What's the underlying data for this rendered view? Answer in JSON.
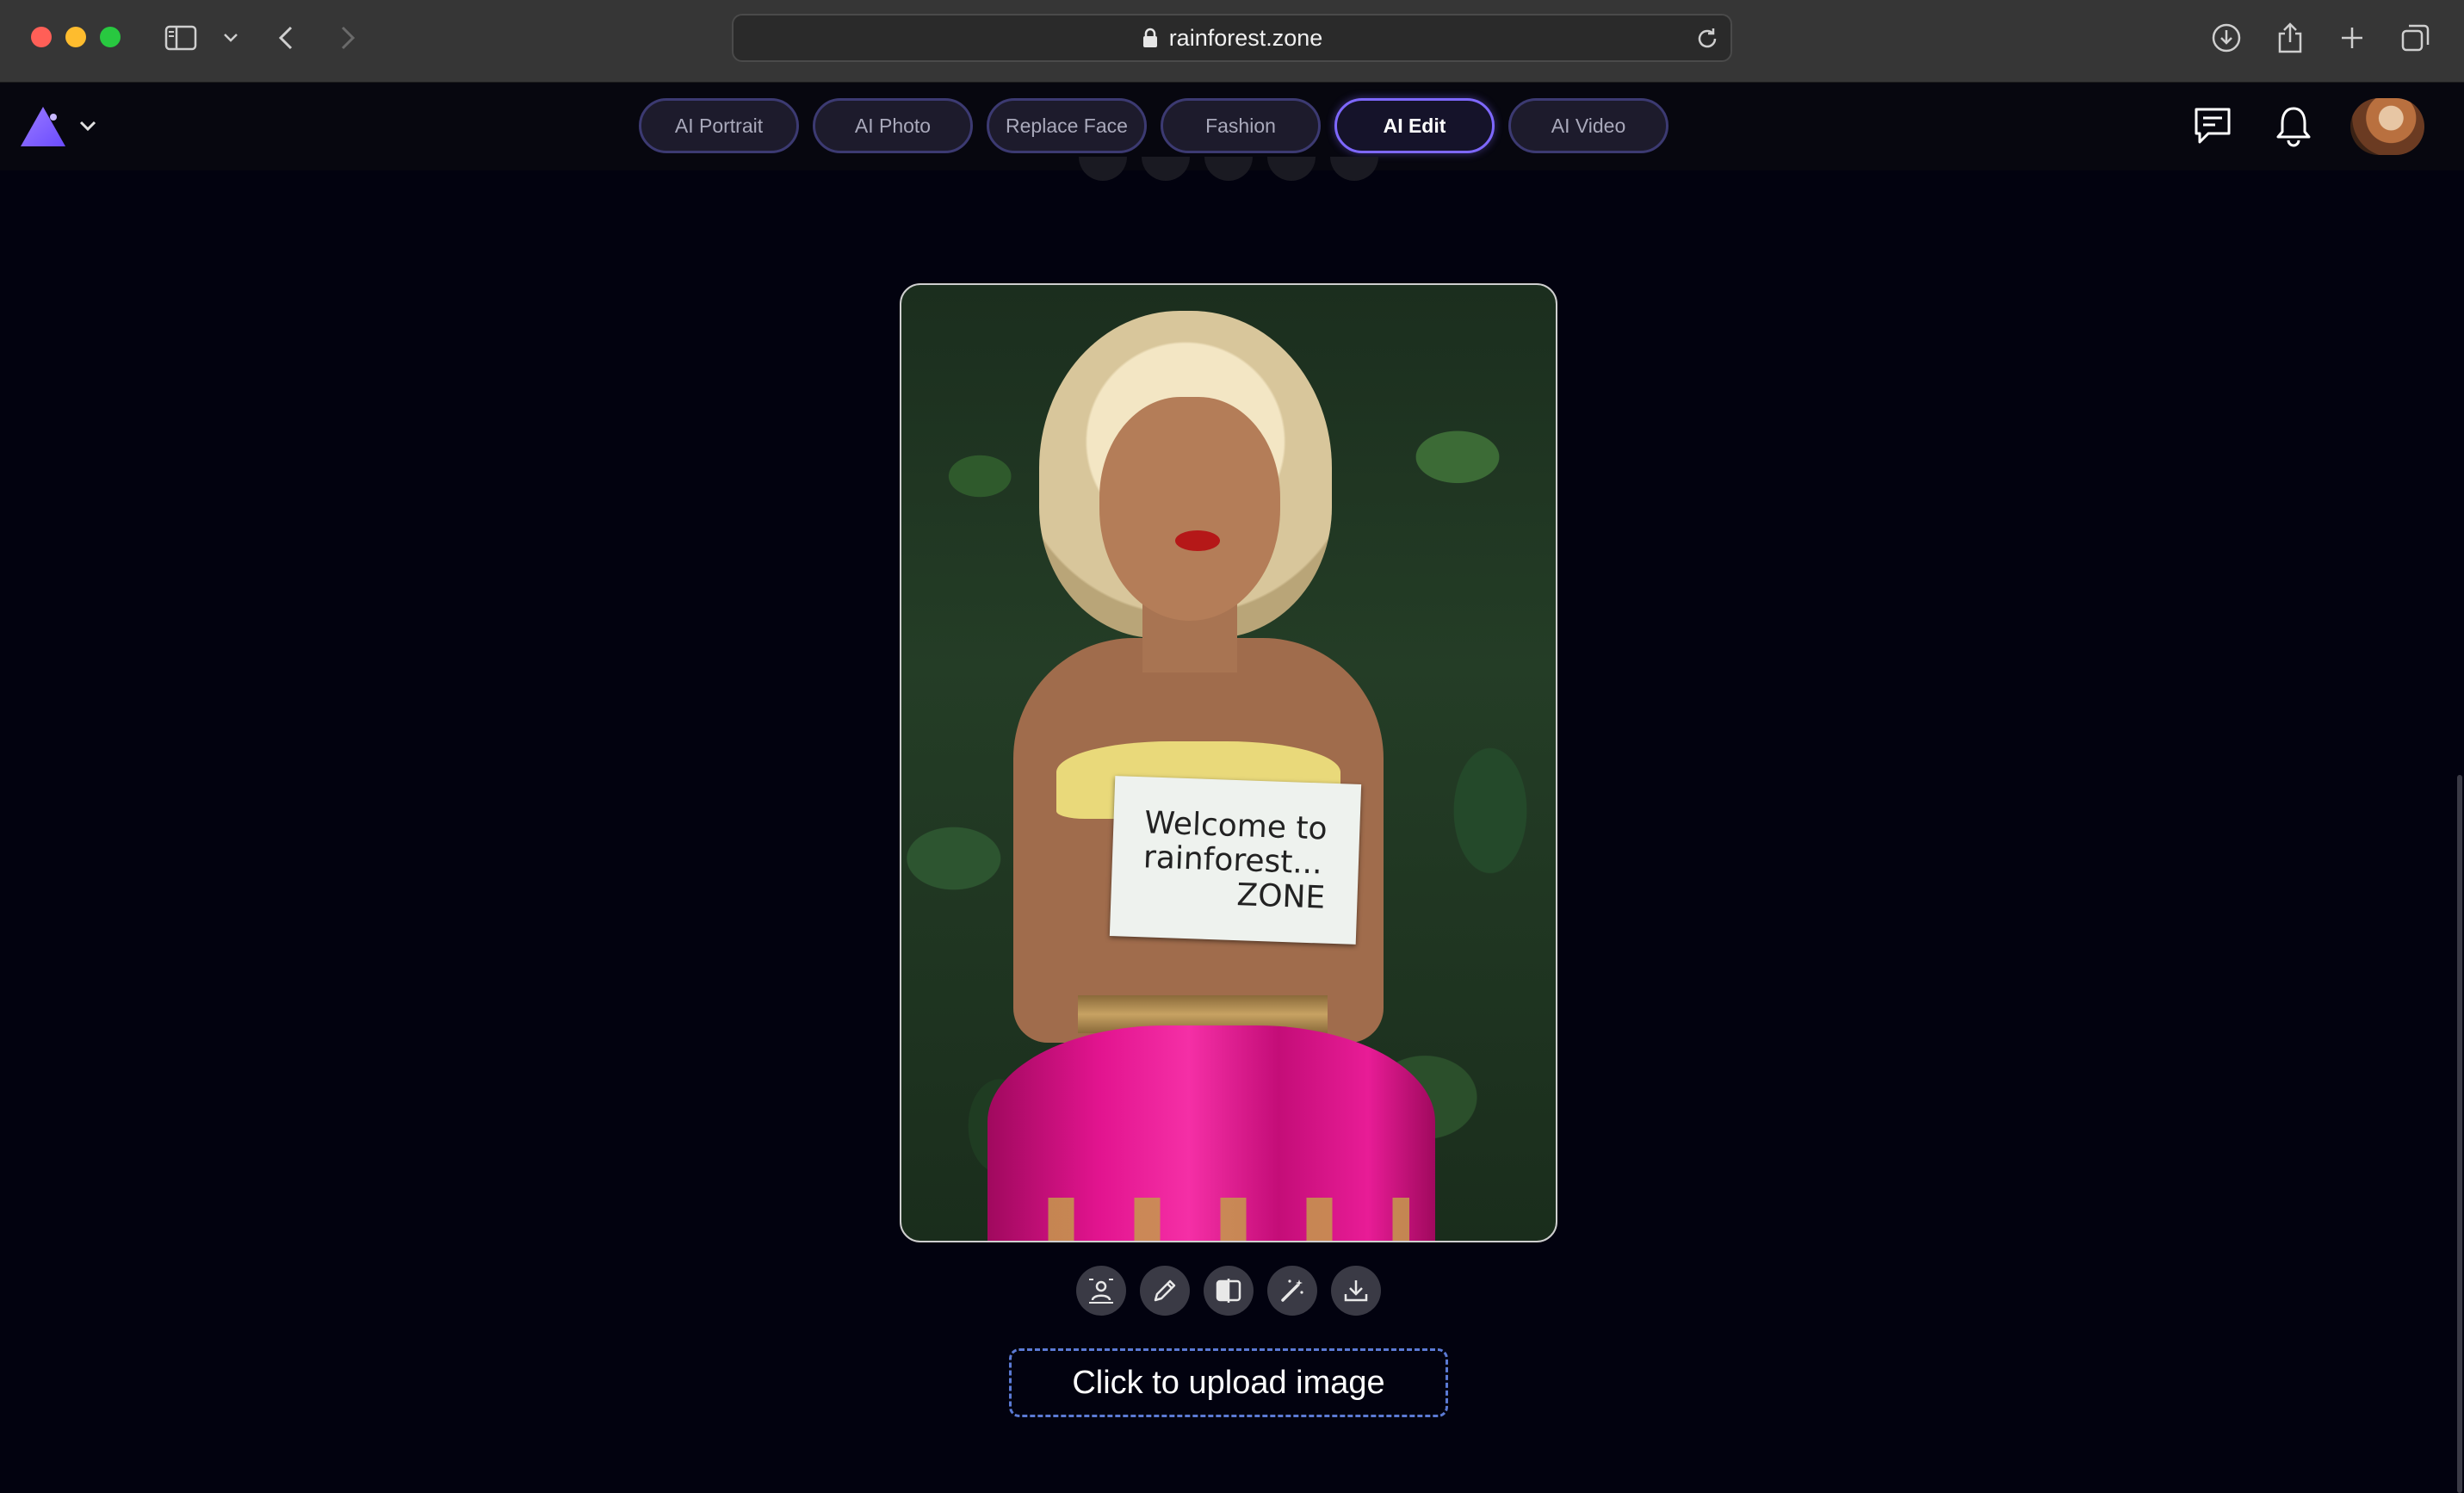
{
  "browser": {
    "url": "rainforest.zone"
  },
  "nav": {
    "tabs": [
      {
        "label": "AI Portrait",
        "active": false
      },
      {
        "label": "AI Photo",
        "active": false
      },
      {
        "label": "Replace Face",
        "active": false
      },
      {
        "label": "Fashion",
        "active": false
      },
      {
        "label": "AI Edit",
        "active": true
      },
      {
        "label": "AI Video",
        "active": false
      }
    ]
  },
  "image": {
    "sign_line1": "Welcome to",
    "sign_line2": "rainforest...",
    "sign_line3": "ZONE"
  },
  "actions": [
    {
      "icon": "remove-background-icon"
    },
    {
      "icon": "pencil-icon"
    },
    {
      "icon": "compare-icon"
    },
    {
      "icon": "magic-wand-icon"
    },
    {
      "icon": "download-icon"
    }
  ],
  "upload": {
    "label": "Click to upload image"
  },
  "colors": {
    "page_bg": "#02020f",
    "accent": "#7e68ff",
    "upload_border": "#5b7ad4"
  }
}
